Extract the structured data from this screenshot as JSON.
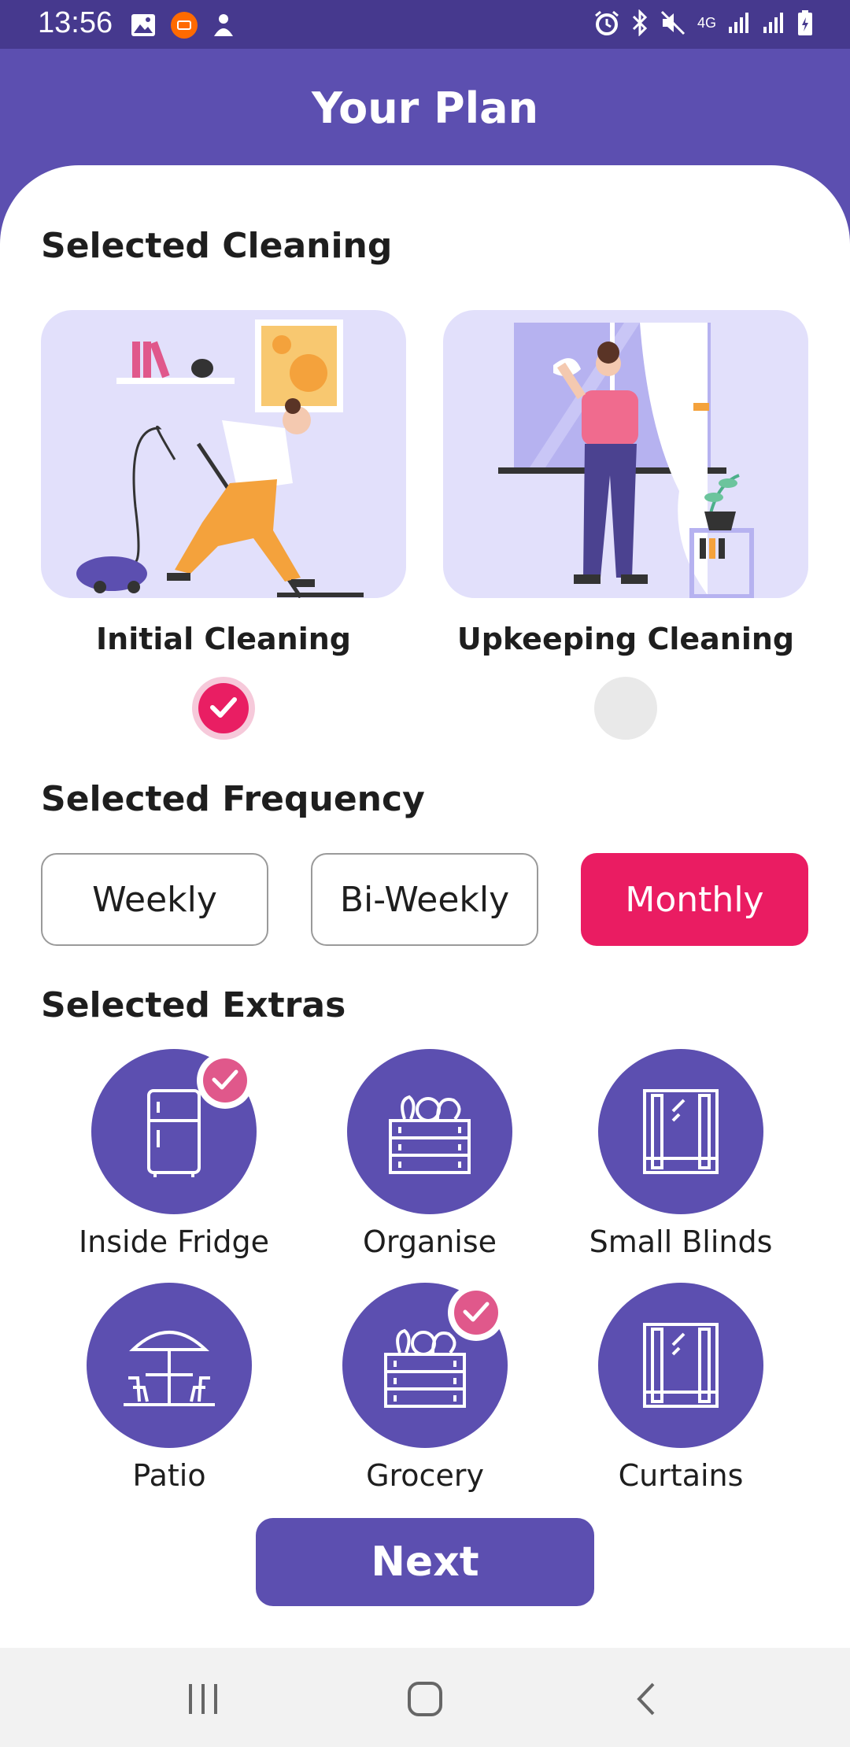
{
  "status_bar": {
    "time": "13:56",
    "left_icons": [
      "image-icon",
      "mi-icon",
      "notification-person-icon"
    ],
    "right_icons": [
      "alarm-icon",
      "bluetooth-icon",
      "mute-icon",
      "4g-icon",
      "signal-icon",
      "signal-icon",
      "battery-icon"
    ],
    "network": "4G"
  },
  "header": {
    "title": "Your Plan"
  },
  "cleaning": {
    "title": "Selected Cleaning",
    "options": [
      {
        "label": "Initial Cleaning",
        "selected": true,
        "illustration": "vacuum-cleaning-illustration"
      },
      {
        "label": "Upkeeping Cleaning",
        "selected": false,
        "illustration": "window-cleaning-illustration"
      }
    ]
  },
  "frequency": {
    "title": "Selected Frequency",
    "options": [
      {
        "label": "Weekly",
        "selected": false
      },
      {
        "label": "Bi-Weekly",
        "selected": false
      },
      {
        "label": "Monthly",
        "selected": true
      }
    ]
  },
  "extras": {
    "title": "Selected Extras",
    "items": [
      {
        "label": "Inside Fridge",
        "icon": "fridge-icon",
        "selected": true
      },
      {
        "label": "Organise",
        "icon": "crate-icon",
        "selected": false
      },
      {
        "label": "Small Blinds",
        "icon": "window-blinds-icon",
        "selected": false
      },
      {
        "label": "Patio",
        "icon": "patio-table-icon",
        "selected": false
      },
      {
        "label": "Grocery",
        "icon": "crate-icon",
        "selected": true
      },
      {
        "label": "Curtains",
        "icon": "window-blinds-icon",
        "selected": false
      }
    ]
  },
  "next_button": {
    "label": "Next"
  },
  "nav": {
    "buttons": [
      "recents-icon",
      "home-icon",
      "back-icon"
    ]
  },
  "colors": {
    "primary": "#5c4fb0",
    "status_bar": "#46398e",
    "accent": "#ea1c62",
    "badge": "#e0588b",
    "card_bg": "#e2e0fb"
  }
}
